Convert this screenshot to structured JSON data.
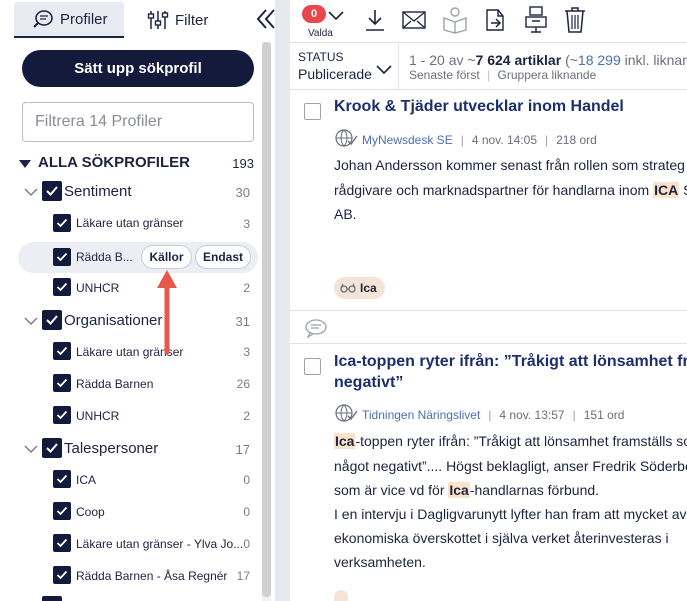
{
  "left": {
    "tabs": {
      "profiler": "Profiler",
      "filter": "Filter"
    },
    "setup_button": "Sätt upp sökprofil",
    "filter_placeholder": "Filtrera 14 Profiler",
    "all_profiles": {
      "label": "ALLA SÖKPROFILER",
      "count": "193"
    },
    "groups": [
      {
        "label": "Sentiment",
        "count": "30",
        "items": [
          {
            "label": "Läkare utan gränser",
            "count": "3"
          },
          {
            "label": "Rädda B...",
            "count": ""
          },
          {
            "label": "UNHCR",
            "count": "2"
          }
        ]
      },
      {
        "label": "Organisationer",
        "count": "31",
        "items": [
          {
            "label": "Läkare utan gränser",
            "count": "3"
          },
          {
            "label": "Rädda Barnen",
            "count": "26"
          },
          {
            "label": "UNHCR",
            "count": "2"
          }
        ]
      },
      {
        "label": "Talespersoner",
        "count": "17",
        "items": [
          {
            "label": "ICA",
            "count": "0"
          },
          {
            "label": "Coop",
            "count": "0"
          },
          {
            "label": "Läkare utan gränser - Ylva Jo...",
            "count": "0"
          },
          {
            "label": "Rädda Barnen - Åsa Regnér",
            "count": "17"
          }
        ]
      }
    ],
    "hover_actions": {
      "kallor": "Källor",
      "endast": "Endast"
    }
  },
  "toolbar": {
    "badge": "0",
    "valda": "Valda"
  },
  "status": {
    "key": "STATUS",
    "value": "Publicerade",
    "range": "1 - 20 av ~",
    "total": "7 624 artiklar",
    "incl_prefix": "(~",
    "incl_count": "18 299",
    "incl_suffix": " inkl. liknan",
    "sort": "Senaste först",
    "group": "Gruppera liknande"
  },
  "articles": [
    {
      "title": "Krook & Tjäder utvecklar inom Handel",
      "source": "MyNewsdesk SE",
      "date": "4 nov. 14:05",
      "words": "218 ord",
      "line1": "Johan Andersson kommer senast från rollen som strateg",
      "line2_pre": "rådgivare och marknadspartner för handlarna inom ",
      "line2_hl": "ICA",
      "line2_post": " S",
      "line3": "AB.",
      "tag": "Ica"
    },
    {
      "title_l1": "Ica-toppen ryter ifrån: ”Tråkigt att lönsamhet fram",
      "title_l2": "negativt”",
      "source": "Tidningen Näringslivet",
      "date": "4 nov. 13:57",
      "words": "151 ord",
      "l1_hl": "Ica",
      "l1_post": "-toppen ryter ifrån: ”Tråkigt att lönsamhet framställs so",
      "l2": "något negativt”.... Högst beklagligt, anser Fredrik Söderbe",
      "l3_pre": "som är vice vd för ",
      "l3_hl": "Ica",
      "l3_post": "-handlarnas förbund.",
      "l4": "I en intervju i Dagligvarunytt lyfter han fram att mycket av",
      "l5": "ekonomiska överskottet i själva verket återinvesteras i",
      "l6": "verksamheten."
    }
  ]
}
